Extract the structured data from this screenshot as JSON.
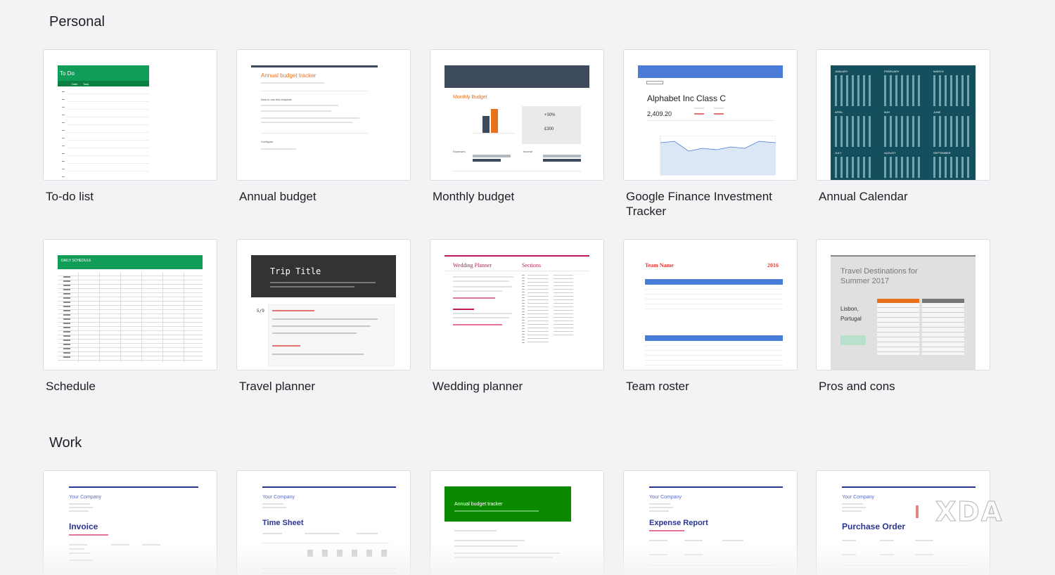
{
  "sections": {
    "personal": "Personal",
    "work": "Work"
  },
  "personal_templates": [
    {
      "name": "To-do list"
    },
    {
      "name": "Annual budget"
    },
    {
      "name": "Monthly budget"
    },
    {
      "name": "Google Finance Investment Tracker"
    },
    {
      "name": "Annual Calendar"
    },
    {
      "name": "Schedule"
    },
    {
      "name": "Travel planner"
    },
    {
      "name": "Wedding planner"
    },
    {
      "name": "Team roster"
    },
    {
      "name": "Pros and cons"
    }
  ],
  "thumbs": {
    "todo": {
      "header": "To Do",
      "col_date": "Date",
      "col_task": "Task"
    },
    "annual_budget": {
      "title": "Annual budget tracker",
      "howto": "How to use this template",
      "configure": "Configure"
    },
    "monthly_budget": {
      "title": "Monthly Budget",
      "pct": "+30%",
      "amount": "£300",
      "expenses": "Expenses",
      "income": "Income"
    },
    "finance": {
      "company": "Alphabet Inc Class C",
      "price": "2,409.20"
    },
    "calendar": {
      "months": [
        "JANUARY",
        "FEBRUARY",
        "MARCH",
        "APRIL",
        "MAY",
        "JUNE",
        "JULY",
        "AUGUST",
        "SEPTEMBER"
      ]
    },
    "schedule": {
      "title": "DAILY SCHEDULE"
    },
    "travel": {
      "title": "Trip Title",
      "date": "5/9"
    },
    "wedding": {
      "title": "Wedding Planner",
      "sections": "Sections"
    },
    "roster": {
      "title": "Team Name",
      "year": "2016"
    },
    "pros": {
      "title": "Travel Destinations for Summer 2017",
      "place": "Lisbon, Portugal"
    },
    "invoice": {
      "company": "Your Company",
      "title": "Invoice"
    },
    "timesheet": {
      "company": "Your Company",
      "title": "Time Sheet"
    },
    "annual_budget_work": {
      "title": "Annual budget tracker"
    },
    "expense": {
      "company": "Your Company",
      "title": "Expense Report"
    },
    "purchase": {
      "company": "Your Company",
      "title": "Purchase Order"
    }
  },
  "watermark": "XDA",
  "colors": {
    "green": "#0f9d58",
    "navy": "#1e3a5f",
    "blue": "#4a7bd6",
    "orange": "#e8711c",
    "dark": "#333333"
  }
}
